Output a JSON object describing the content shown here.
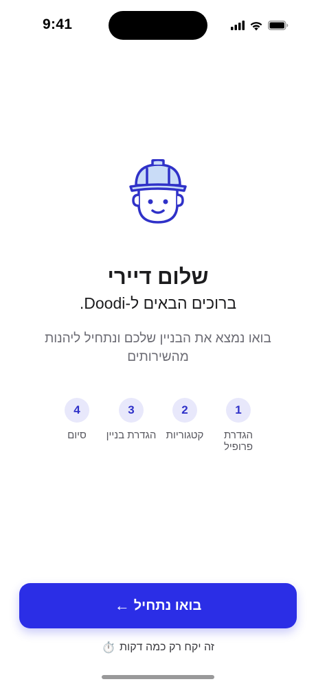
{
  "status_bar": {
    "time": "9:41"
  },
  "hero": {
    "icon": "worker-helmet-face-icon",
    "accent_color": "#2f31c8",
    "helmet_fill": "#c9dcf7"
  },
  "welcome": {
    "title": "שלום דיירי",
    "subtitle": "ברוכים הבאים ל-Doodi.",
    "description": "בואו נמצא את הבניין שלכם ונתחיל ליהנות מהשירותים"
  },
  "steps": [
    {
      "number": "1",
      "label": "הגדרת פרופיל"
    },
    {
      "number": "2",
      "label": "קטגוריות"
    },
    {
      "number": "3",
      "label": "הגדרת בניין"
    },
    {
      "number": "4",
      "label": "סיום"
    }
  ],
  "cta": {
    "label": "בואו נתחיל",
    "arrow": "←",
    "color": "#2b2ee6"
  },
  "footnote": {
    "text": "זה יקח רק כמה דקות",
    "icon": "⏱️"
  }
}
